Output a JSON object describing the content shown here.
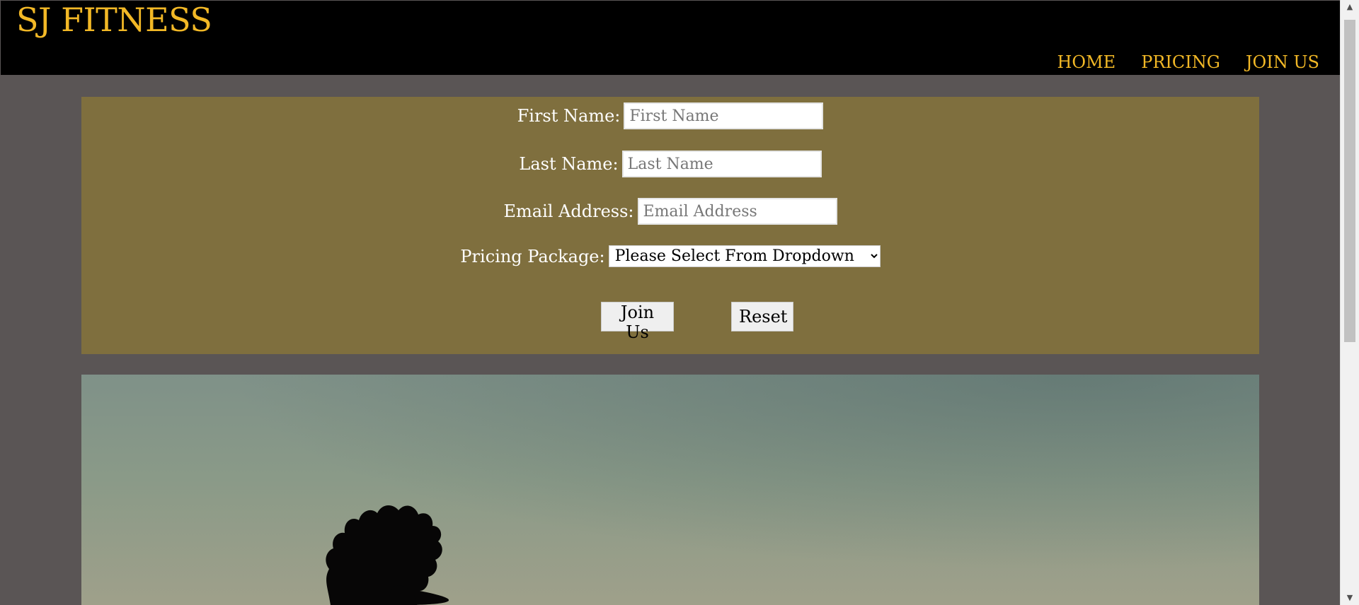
{
  "brand": "SJ FITNESS",
  "nav": [
    "HOME",
    "PRICING",
    "JOIN US"
  ],
  "form": {
    "first_name": {
      "label": "First Name:",
      "placeholder": "First Name"
    },
    "last_name": {
      "label": "Last Name:",
      "placeholder": "Last Name"
    },
    "email": {
      "label": "Email Address:",
      "placeholder": "Email Address"
    },
    "package": {
      "label": "Pricing Package:",
      "selected": "Please Select From Dropdown"
    },
    "submit_label": "Join Us",
    "reset_label": "Reset"
  },
  "colors": {
    "header_bg": "#000000",
    "brand": "#f2b826",
    "page_bg": "#5a5555",
    "form_bg": "#7f6f3e"
  },
  "icons": {
    "scroll_up": "triangle-up-icon",
    "scroll_down": "triangle-down-icon",
    "dropdown": "chevron-down-icon"
  }
}
